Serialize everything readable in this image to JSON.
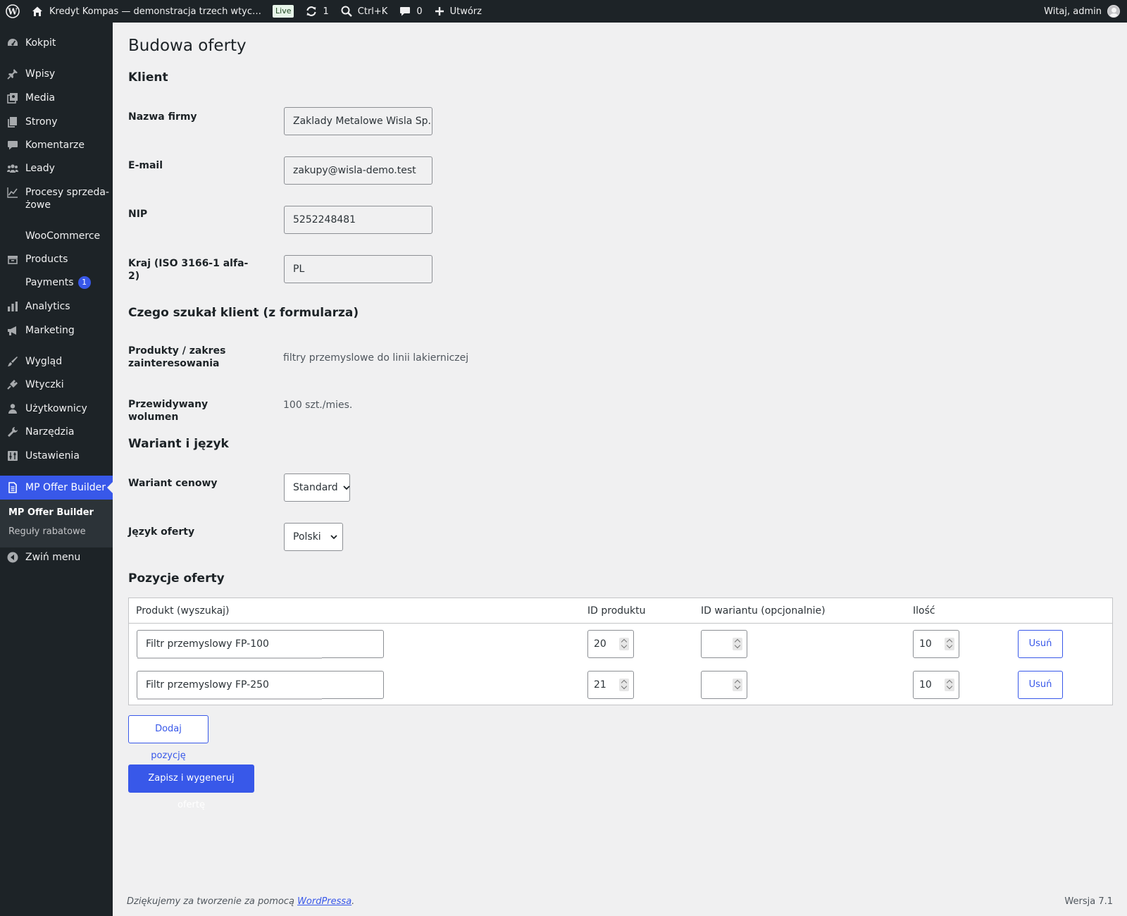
{
  "adminbar": {
    "site_title": "Kredyt Kompas — demonstracja trzech wtyc…",
    "live_label": "Live",
    "updates_count": "1",
    "search_shortcut": "Ctrl+K",
    "comments_count": "0",
    "create_label": "Utwórz",
    "greeting": "Witaj, admin"
  },
  "sidebar": {
    "items": [
      {
        "label": "Kokpit",
        "icon": "dashboard-icon"
      },
      {
        "label": "Wpisy",
        "icon": "pin-icon"
      },
      {
        "label": "Media",
        "icon": "media-icon"
      },
      {
        "label": "Strony",
        "icon": "page-icon"
      },
      {
        "label": "Komentarze",
        "icon": "comment-icon"
      },
      {
        "label": "Leady",
        "icon": "groups-icon"
      },
      {
        "label": "Procesy sprzeda-",
        "label2": "żowe",
        "icon": "chart-line-icon"
      },
      {
        "label": "WooCommerce",
        "icon": "woocommerce-icon"
      },
      {
        "label": "Products",
        "icon": "archive-icon"
      },
      {
        "label": "Payments",
        "icon": "payments-icon",
        "badge": "1"
      },
      {
        "label": "Analytics",
        "icon": "bar-chart-icon"
      },
      {
        "label": "Marketing",
        "icon": "megaphone-icon"
      },
      {
        "label": "Wygląd",
        "icon": "brush-icon"
      },
      {
        "label": "Wtyczki",
        "icon": "plugin-icon"
      },
      {
        "label": "Użytkownicy",
        "icon": "user-icon"
      },
      {
        "label": "Narzędzia",
        "icon": "wrench-icon"
      },
      {
        "label": "Ustawienia",
        "icon": "settings-icon"
      },
      {
        "label": "MP Offer Builder",
        "icon": "document-icon"
      }
    ],
    "submenu": [
      "MP Offer Builder",
      "Reguły rabatowe"
    ],
    "collapse_label": "Zwiń menu"
  },
  "page": {
    "title": "Budowa oferty",
    "section_client": "Klient",
    "company_label": "Nazwa firmy",
    "company_value": "Zaklady Metalowe Wisla Sp. z",
    "email_label": "E-mail",
    "email_value": "zakupy@wisla-demo.test",
    "nip_label": "NIP",
    "nip_value": "5252248481",
    "country_label": "Kraj (ISO 3166-1 alfa-2)",
    "country_value": "PL",
    "section_search": "Czego szukał klient (z formularza)",
    "products_label": "Produkty / zakres zainteresowania",
    "products_value": "filtry przemyslowe do linii lakierniczej",
    "volume_label": "Przewidywany wolumen",
    "volume_value": "100 szt./mies.",
    "section_variant": "Wariant i język",
    "price_variant_label": "Wariant cenowy",
    "price_variant_value": "Standard",
    "language_label": "Język oferty",
    "language_value": "Polski",
    "section_items": "Pozycje oferty"
  },
  "table": {
    "headers": [
      "Produkt (wyszukaj)",
      "ID produktu",
      "ID wariantu (opcjonalnie)",
      "Ilość"
    ],
    "rows": [
      {
        "product": "Filtr przemyslowy FP-100",
        "product_id": "20",
        "variant_id": "",
        "qty": "10",
        "remove": "Usuń"
      },
      {
        "product": "Filtr przemyslowy FP-250",
        "product_id": "21",
        "variant_id": "",
        "qty": "10",
        "remove": "Usuń"
      }
    ]
  },
  "actions": {
    "add_item": "Dodaj pozycję",
    "save": "Zapisz i wygeneruj ofertę"
  },
  "footer": {
    "thanks_prefix": "Dziękujemy za tworzenie za pomocą ",
    "thanks_link": "WordPressa",
    "thanks_suffix": ".",
    "version": "Wersja 7.1"
  },
  "colors": {
    "accent": "#3858e9",
    "sidebar_bg": "#1d2327",
    "page_bg": "#f0f0f1"
  }
}
